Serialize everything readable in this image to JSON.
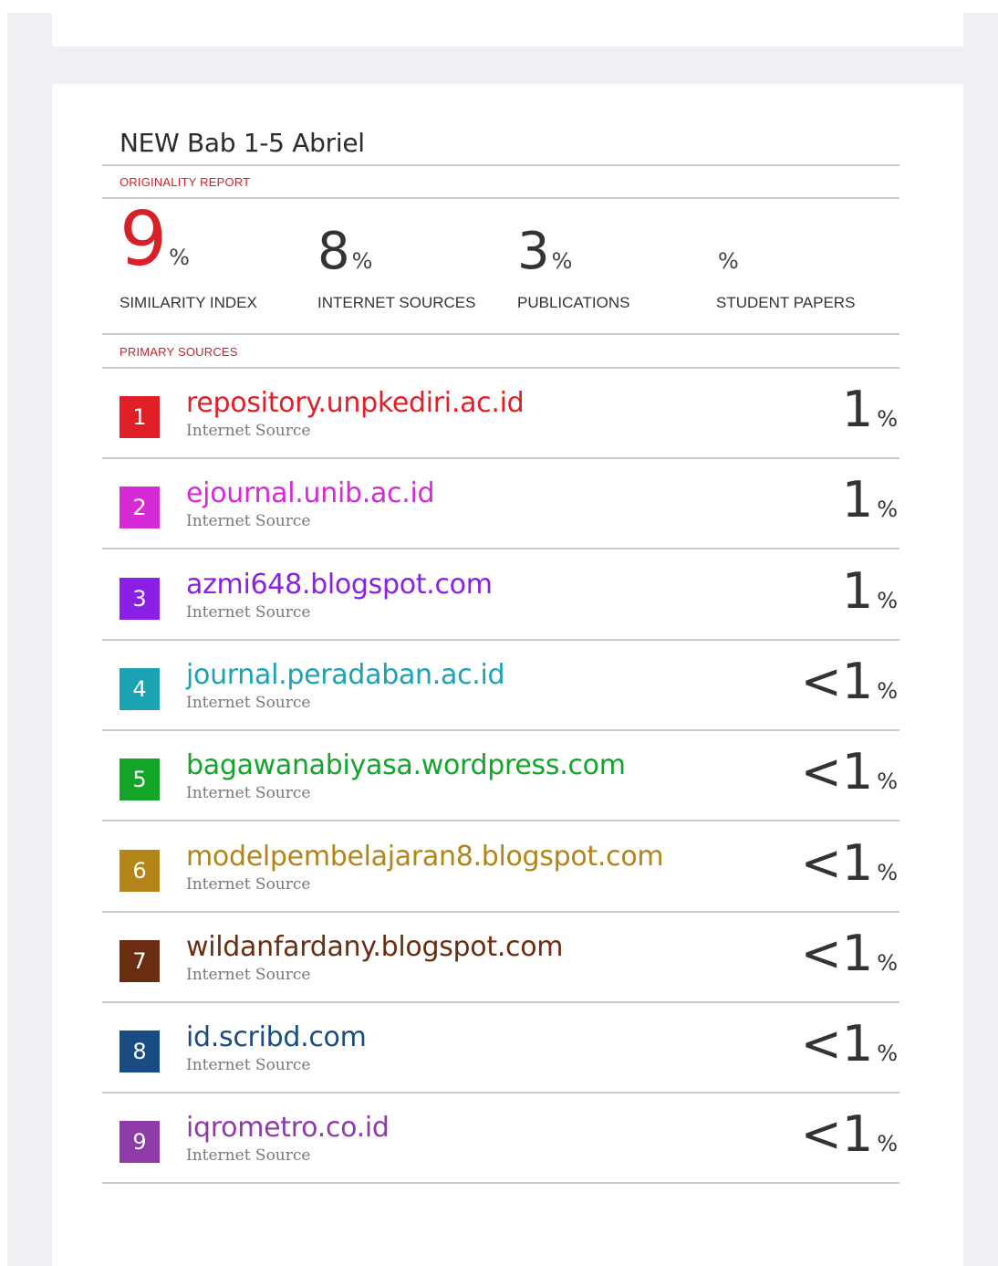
{
  "document": {
    "title": "NEW Bab 1-5 Abriel"
  },
  "report": {
    "originality_label": "ORIGINALITY REPORT",
    "primary_sources_label": "PRIMARY SOURCES",
    "percent_sign": "%",
    "stats": [
      {
        "value": "9",
        "label": "SIMILARITY INDEX"
      },
      {
        "value": "8",
        "label": "INTERNET SOURCES"
      },
      {
        "value": "3",
        "label": "PUBLICATIONS"
      },
      {
        "value": "",
        "label": "STUDENT PAPERS"
      }
    ]
  },
  "sources": [
    {
      "rank": "1",
      "name": "repository.unpkediri.ac.id",
      "type": "Internet Source",
      "percent": "1",
      "color": "#e11f26"
    },
    {
      "rank": "2",
      "name": "ejournal.unib.ac.id",
      "type": "Internet Source",
      "percent": "1",
      "color": "#d62ad6"
    },
    {
      "rank": "3",
      "name": "azmi648.blogspot.com",
      "type": "Internet Source",
      "percent": "1",
      "color": "#8a1fe6"
    },
    {
      "rank": "4",
      "name": "journal.peradaban.ac.id",
      "type": "Internet Source",
      "percent": "<1",
      "color": "#1ba3b3"
    },
    {
      "rank": "5",
      "name": "bagawanabiyasa.wordpress.com",
      "type": "Internet Source",
      "percent": "<1",
      "color": "#12a52a"
    },
    {
      "rank": "6",
      "name": "modelpembelajaran8.blogspot.com",
      "type": "Internet Source",
      "percent": "<1",
      "color": "#b38418"
    },
    {
      "rank": "7",
      "name": "wildanfardany.blogspot.com",
      "type": "Internet Source",
      "percent": "<1",
      "color": "#6b2d12"
    },
    {
      "rank": "8",
      "name": "id.scribd.com",
      "type": "Internet Source",
      "percent": "<1",
      "color": "#184c82"
    },
    {
      "rank": "9",
      "name": "iqrometro.co.id",
      "type": "Internet Source",
      "percent": "<1",
      "color": "#8e3aa8"
    }
  ]
}
